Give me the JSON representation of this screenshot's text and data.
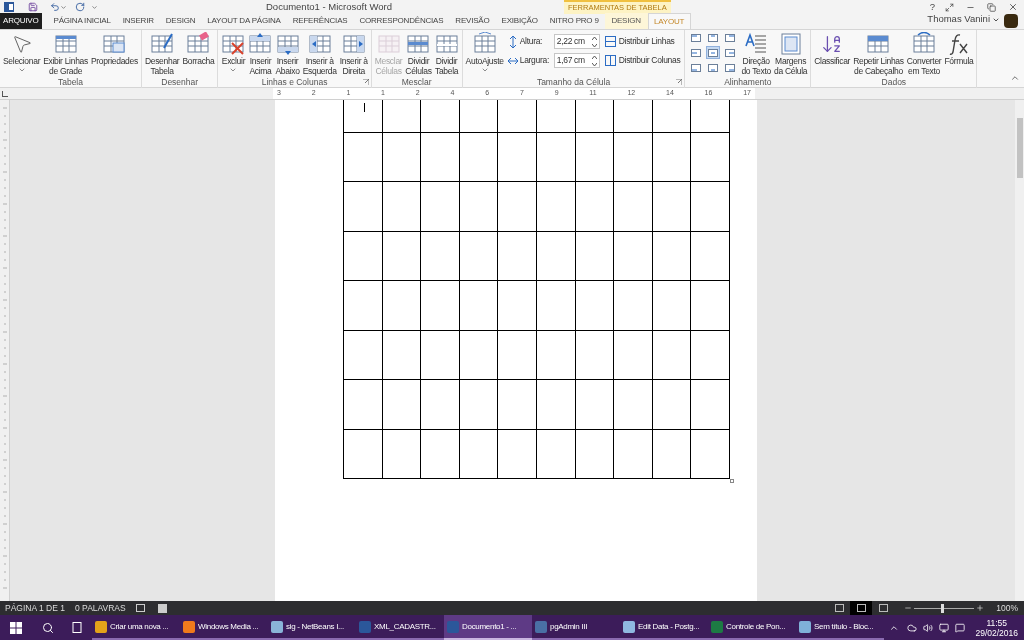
{
  "title_bar": {
    "title": "Documento1 - Microsoft Word",
    "context_header": "FERRAMENTAS DE TABELA",
    "help": "?",
    "user": "Thomas Vanini"
  },
  "tabs": [
    {
      "label": "ARQUIVO",
      "kind": "file",
      "selected": false
    },
    {
      "label": "PÁGINA INICIAL",
      "kind": "normal",
      "selected": false
    },
    {
      "label": "INSERIR",
      "kind": "normal",
      "selected": false
    },
    {
      "label": "DESIGN",
      "kind": "normal",
      "selected": false
    },
    {
      "label": "LAYOUT DA PÁGINA",
      "kind": "normal",
      "selected": false
    },
    {
      "label": "REFERÊNCIAS",
      "kind": "normal",
      "selected": false
    },
    {
      "label": "CORRESPONDÊNCIAS",
      "kind": "normal",
      "selected": false
    },
    {
      "label": "REVISÃO",
      "kind": "normal",
      "selected": false
    },
    {
      "label": "EXIBIÇÃO",
      "kind": "normal",
      "selected": false
    },
    {
      "label": "NITRO PRO 9",
      "kind": "normal",
      "selected": false
    },
    {
      "label": "DESIGN",
      "kind": "context",
      "selected": false
    },
    {
      "label": "LAYOUT",
      "kind": "context",
      "selected": true
    }
  ],
  "ribbon_groups": [
    {
      "name": "Tabela",
      "launcher": false,
      "items": [
        {
          "kind": "large",
          "lines": [
            "Selecionar"
          ],
          "dropdown": true,
          "disabled": false
        },
        {
          "kind": "large",
          "lines": [
            "Exibir Linhas",
            "de Grade"
          ],
          "dropdown": false,
          "disabled": false
        },
        {
          "kind": "large",
          "lines": [
            "Propriedades"
          ],
          "dropdown": false,
          "disabled": false
        }
      ]
    },
    {
      "name": "Desenhar",
      "launcher": false,
      "items": [
        {
          "kind": "large",
          "lines": [
            "Desenhar",
            "Tabela"
          ],
          "dropdown": false,
          "disabled": false
        },
        {
          "kind": "large",
          "lines": [
            "Borracha"
          ],
          "dropdown": false,
          "disabled": false
        }
      ]
    },
    {
      "name": "Linhas e Colunas",
      "launcher": true,
      "items": [
        {
          "kind": "large",
          "lines": [
            "Excluir"
          ],
          "dropdown": true,
          "disabled": false
        },
        {
          "kind": "large",
          "lines": [
            "Inserir",
            "Acima"
          ],
          "dropdown": false,
          "disabled": false
        },
        {
          "kind": "large",
          "lines": [
            "Inserir",
            "Abaixo"
          ],
          "dropdown": false,
          "disabled": false
        },
        {
          "kind": "large",
          "lines": [
            "Inserir à",
            "Esquerda"
          ],
          "dropdown": false,
          "disabled": false
        },
        {
          "kind": "large",
          "lines": [
            "Inserir à",
            "Direita"
          ],
          "dropdown": false,
          "disabled": false
        }
      ]
    },
    {
      "name": "Mesclar",
      "launcher": false,
      "items": [
        {
          "kind": "large",
          "lines": [
            "Mesclar",
            "Células"
          ],
          "dropdown": false,
          "disabled": true
        },
        {
          "kind": "large",
          "lines": [
            "Dividir",
            "Células"
          ],
          "dropdown": false,
          "disabled": false
        },
        {
          "kind": "large",
          "lines": [
            "Dividir",
            "Tabela"
          ],
          "dropdown": false,
          "disabled": false
        }
      ]
    },
    {
      "name": "Tamanho da Célula",
      "launcher": true,
      "items": [
        {
          "kind": "large",
          "lines": [
            "AutoAjuste"
          ],
          "dropdown": true,
          "disabled": false
        },
        {
          "kind": "stack",
          "items": [
            {
              "kind": "field",
              "label": "Altura:",
              "value": "2,22 cm"
            },
            {
              "kind": "field",
              "label": "Largura:",
              "value": "1,67 cm"
            }
          ]
        },
        {
          "kind": "stack",
          "items": [
            {
              "kind": "small",
              "label": "Distribuir Linhas"
            },
            {
              "kind": "small",
              "label": "Distribuir Colunas"
            }
          ]
        }
      ]
    },
    {
      "name": "Alinhamento",
      "launcher": false,
      "items": [
        {
          "kind": "grid",
          "cells": [
            {
              "selected": false
            },
            {
              "selected": false
            },
            {
              "selected": false
            },
            {
              "selected": false
            },
            {
              "selected": true
            },
            {
              "selected": false
            },
            {
              "selected": false
            },
            {
              "selected": false
            },
            {
              "selected": false
            }
          ]
        },
        {
          "kind": "large",
          "lines": [
            "Direção",
            "do Texto"
          ],
          "dropdown": false,
          "disabled": false
        },
        {
          "kind": "large",
          "lines": [
            "Margens",
            "da Célula"
          ],
          "dropdown": false,
          "disabled": false
        }
      ]
    },
    {
      "name": "Dados",
      "launcher": false,
      "items": [
        {
          "kind": "large",
          "lines": [
            "Classificar"
          ],
          "dropdown": false,
          "disabled": false
        },
        {
          "kind": "large",
          "lines": [
            "Repetir Linhas",
            "de Cabeçalho"
          ],
          "dropdown": false,
          "disabled": false
        },
        {
          "kind": "large",
          "lines": [
            "Converter",
            "em Texto"
          ],
          "dropdown": false,
          "disabled": false
        },
        {
          "kind": "large",
          "lines": [
            "Fórmula"
          ],
          "dropdown": false,
          "disabled": false
        }
      ]
    }
  ],
  "ruler": {
    "labels": [
      "3",
      "2",
      "1",
      "1",
      "2",
      "4",
      "6",
      "7",
      "9",
      "11",
      "12",
      "14",
      "16",
      "17"
    ]
  },
  "status_bar": {
    "page": "PÁGINA 1 DE 1",
    "words": "0 PALAVRAS",
    "views": [
      {
        "selected": false
      },
      {
        "selected": true
      },
      {
        "selected": false
      }
    ],
    "zoom": {
      "level": 0.45,
      "reading": "100%"
    }
  },
  "taskbar": {
    "apps": [
      {
        "label": "Criar uma nova ...",
        "selected": false
      },
      {
        "label": "Windows Media ...",
        "selected": false
      },
      {
        "label": "sig - NetBeans I...",
        "selected": false
      },
      {
        "label": "XML_CADASTR...",
        "selected": false
      },
      {
        "label": "Documento1 - ...",
        "selected": true
      },
      {
        "label": "pgAdmin III",
        "selected": false
      },
      {
        "label": "Edit Data - Postg...",
        "selected": false
      },
      {
        "label": "Controle de Pon...",
        "selected": false
      },
      {
        "label": "Sem título - Bloc...",
        "selected": false
      }
    ],
    "time": "11:55",
    "date": "29/02/2016"
  }
}
